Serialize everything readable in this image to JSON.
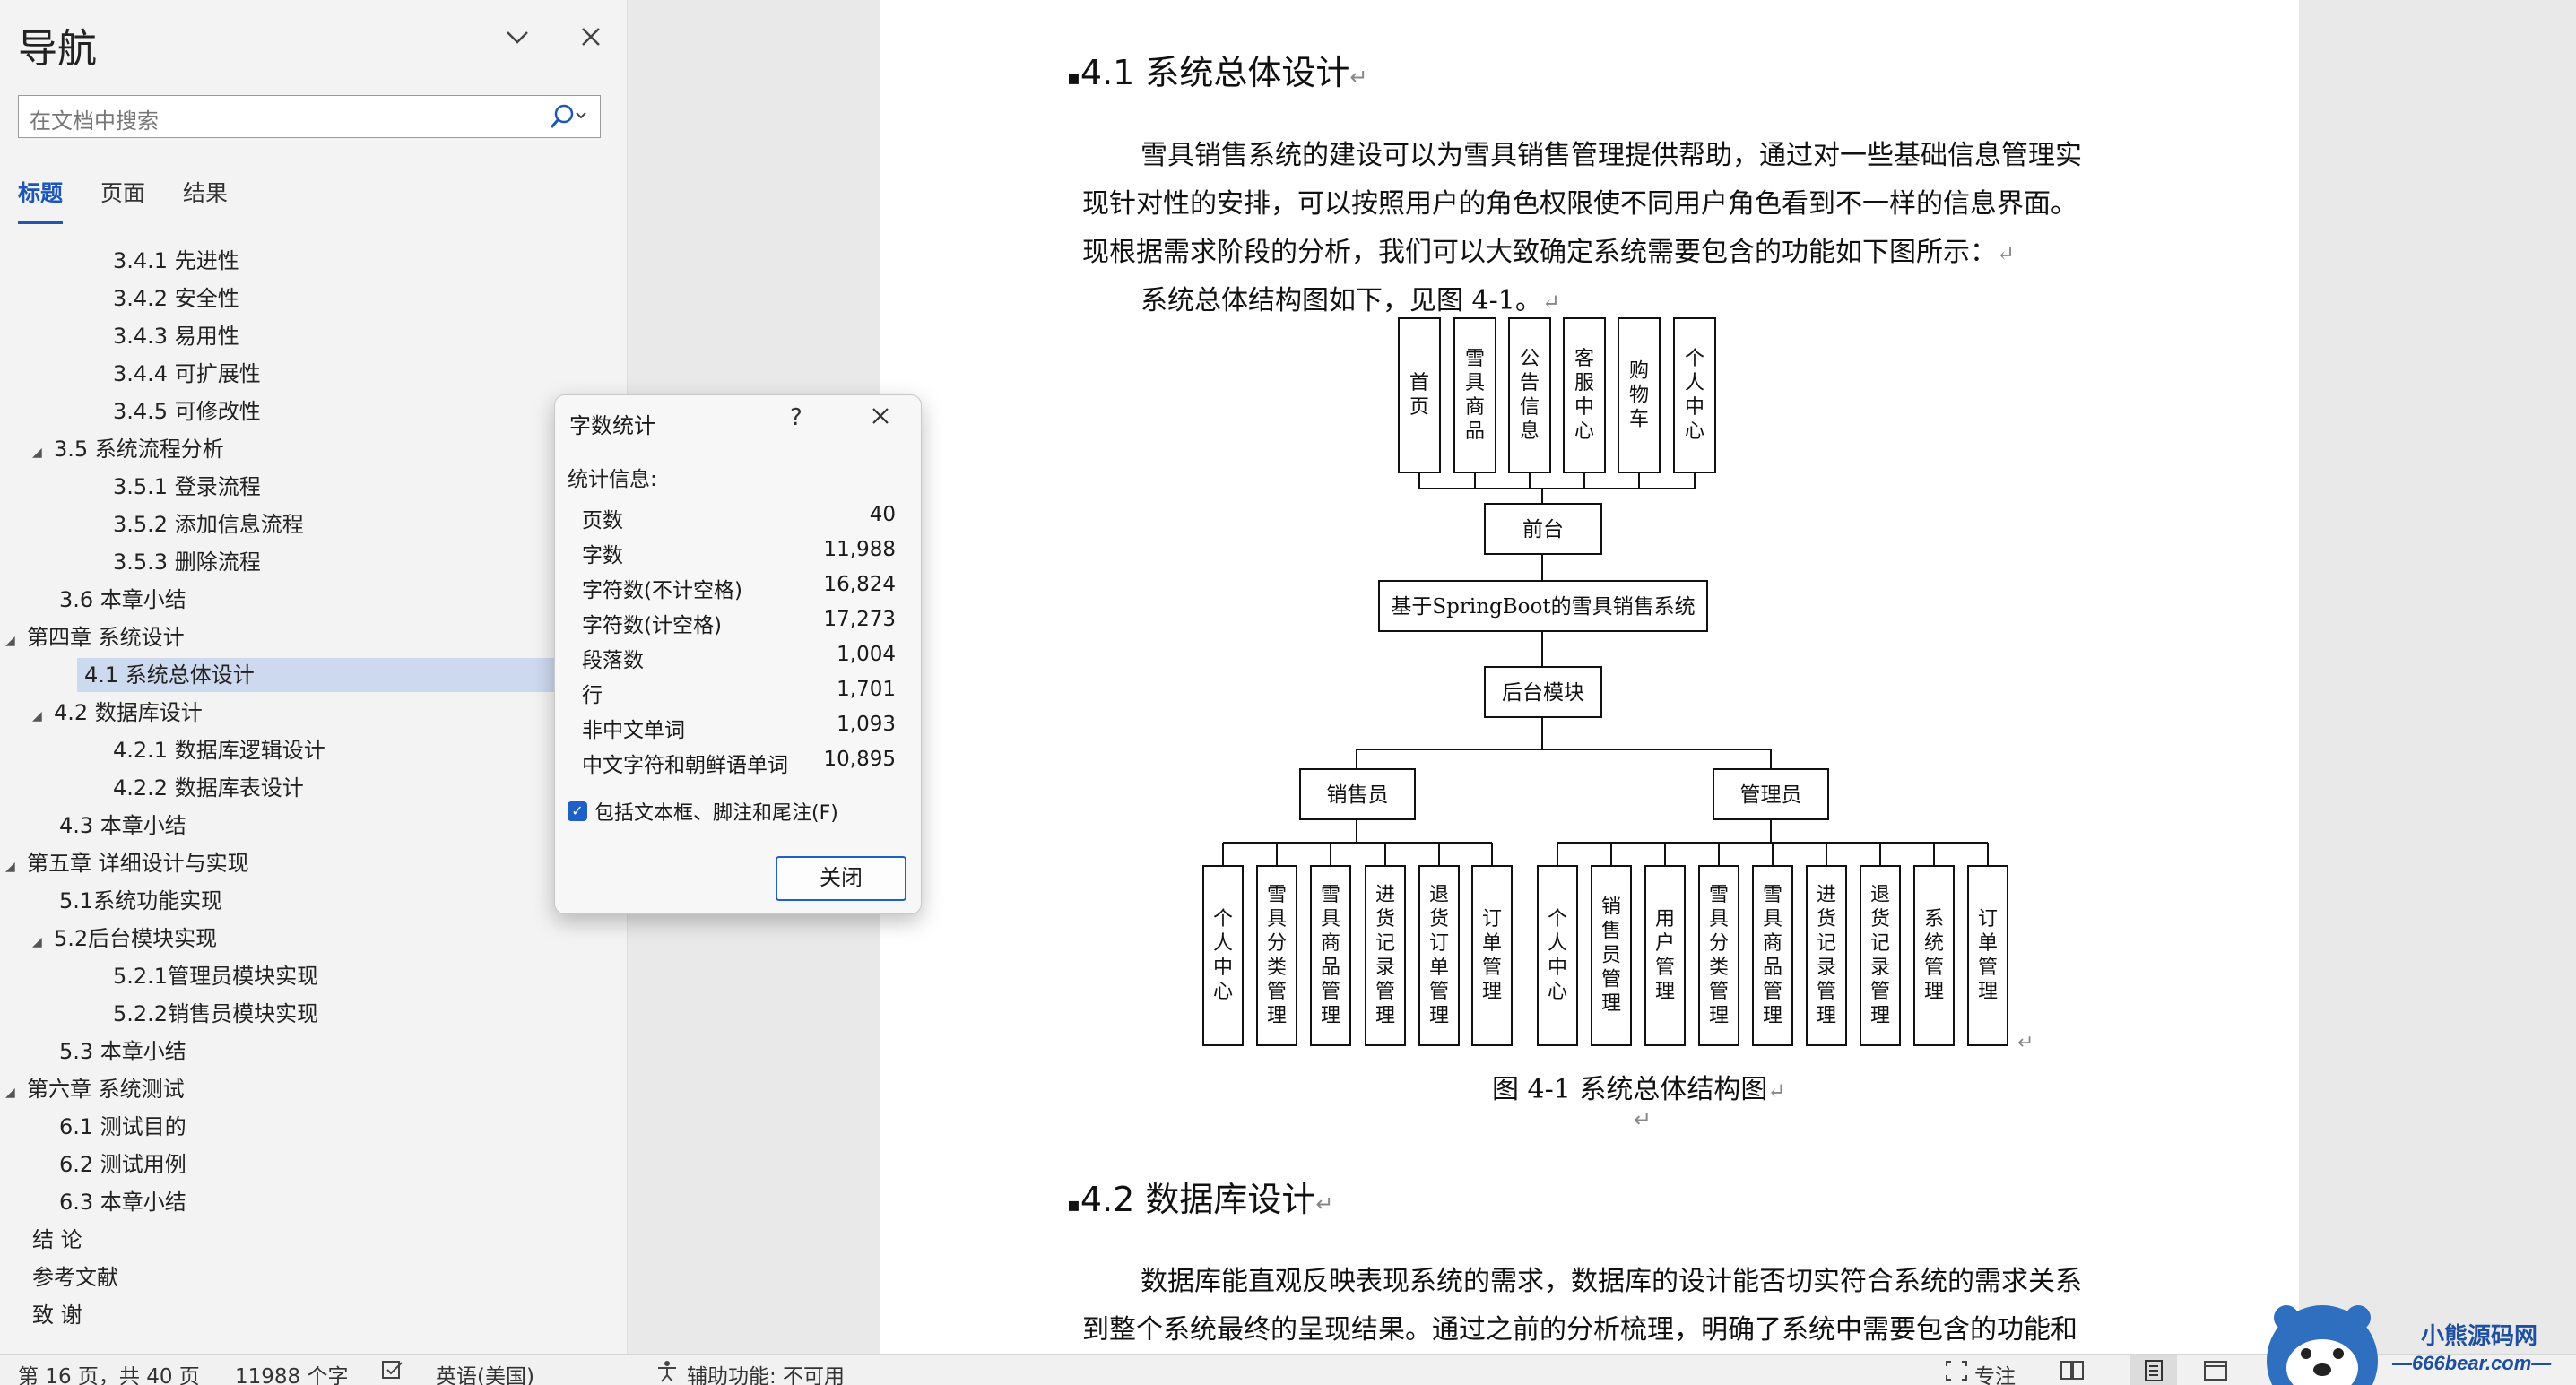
{
  "nav": {
    "title": "导航",
    "search_placeholder": "在文档中搜索",
    "tabs": [
      "标题",
      "页面",
      "结果"
    ],
    "items": [
      {
        "label": "3.4.1 先进性",
        "level": 3,
        "caret": ""
      },
      {
        "label": "3.4.2 安全性",
        "level": 3,
        "caret": ""
      },
      {
        "label": "3.4.3 易用性",
        "level": 3,
        "caret": ""
      },
      {
        "label": "3.4.4 可扩展性",
        "level": 3,
        "caret": ""
      },
      {
        "label": "3.4.5 可修改性",
        "level": 3,
        "caret": ""
      },
      {
        "label": "3.5 系统流程分析",
        "level": 2,
        "caret": "◢"
      },
      {
        "label": "3.5.1 登录流程",
        "level": 3,
        "caret": ""
      },
      {
        "label": "3.5.2 添加信息流程",
        "level": 3,
        "caret": ""
      },
      {
        "label": "3.5.3 删除流程",
        "level": 3,
        "caret": ""
      },
      {
        "label": "3.6 本章小结",
        "level": 2,
        "caret": ""
      },
      {
        "label": "第四章 系统设计",
        "level": 1,
        "caret": "◢"
      },
      {
        "label": "4.1 系统总体设计",
        "level": 2,
        "caret": "",
        "selected": true
      },
      {
        "label": "4.2 数据库设计",
        "level": 2,
        "caret": "◢"
      },
      {
        "label": "4.2.1 数据库逻辑设计",
        "level": 3,
        "caret": ""
      },
      {
        "label": "4.2.2 数据库表设计",
        "level": 3,
        "caret": ""
      },
      {
        "label": "4.3 本章小结",
        "level": 2,
        "caret": ""
      },
      {
        "label": "第五章 详细设计与实现",
        "level": 1,
        "caret": "◢"
      },
      {
        "label": "5.1系统功能实现",
        "level": 2,
        "caret": ""
      },
      {
        "label": "5.2后台模块实现",
        "level": 2,
        "caret": "◢"
      },
      {
        "label": "5.2.1管理员模块实现",
        "level": 3,
        "caret": ""
      },
      {
        "label": "5.2.2销售员模块实现",
        "level": 3,
        "caret": ""
      },
      {
        "label": "5.3 本章小结",
        "level": 2,
        "caret": ""
      },
      {
        "label": "第六章 系统测试",
        "level": 1,
        "caret": "◢"
      },
      {
        "label": "6.1 测试目的",
        "level": 2,
        "caret": ""
      },
      {
        "label": "6.2 测试用例",
        "level": 2,
        "caret": ""
      },
      {
        "label": "6.3 本章小结",
        "level": 2,
        "caret": ""
      },
      {
        "label": "结  论",
        "level": 1,
        "caret": ""
      },
      {
        "label": "参考文献",
        "level": 1,
        "caret": ""
      },
      {
        "label": "致  谢",
        "level": 1,
        "caret": ""
      }
    ]
  },
  "doc": {
    "h41": "4.1  系统总体设计",
    "p1": "雪具销售系统的建设可以为雪具销售管理提供帮助，通过对一些基础信息管理实",
    "p2": "现针对性的安排，可以按照用户的角色权限使不同用户角色看到不一样的信息界面。",
    "p3": "现根据需求阶段的分析，我们可以大致确定系统需要包含的功能如下图所示：",
    "p4": "系统总体结构图如下，见图 4-1。",
    "fig_caption": "图 4-1  系统总体结构图",
    "h42": "4.2  数据库设计",
    "p5": "数据库能直观反映表现系统的需求，数据库的设计能否切实符合系统的需求关系",
    "p6": "到整个系统最终的呈现结果。通过之前的分析梳理，明确了系统中需要包含的功能和",
    "return_mark": "↵"
  },
  "diagram": {
    "front_items": [
      "首页",
      "雪具商品",
      "公告信息",
      "客服中心",
      "购物车",
      "个人中心"
    ],
    "front": "前台",
    "system": "基于SpringBoot的雪具销售系统",
    "backend": "后台模块",
    "seller": "销售员",
    "admin": "管理员",
    "seller_items": [
      "个人中心",
      "雪具分类管理",
      "雪具商品管理",
      "进货记录管理",
      "退货订单管理",
      "订单管理"
    ],
    "admin_items": [
      "个人中心",
      "销售员管理",
      "用户管理",
      "雪具分类管理",
      "雪具商品管理",
      "进货记录管理",
      "退货记录管理",
      "系统管理",
      "订单管理"
    ]
  },
  "dialog": {
    "title": "字数统计",
    "help": "?",
    "section": "统计信息:",
    "stats": [
      {
        "label": "页数",
        "value": "40"
      },
      {
        "label": "字数",
        "value": "11,988"
      },
      {
        "label": "字符数(不计空格)",
        "value": "16,824"
      },
      {
        "label": "字符数(计空格)",
        "value": "17,273"
      },
      {
        "label": "段落数",
        "value": "1,004"
      },
      {
        "label": "行",
        "value": "1,701"
      },
      {
        "label": "非中文单词",
        "value": "1,093"
      },
      {
        "label": "中文字符和朝鲜语单词",
        "value": "10,895"
      }
    ],
    "checkbox_label": "包括文本框、脚注和尾注(F)",
    "checkbox_checked": true,
    "close_label": "关闭"
  },
  "status": {
    "page": "第 16 页，共 40 页",
    "words": "11988 个字",
    "language": "英语(美国)",
    "accessibility": "辅助功能: 不可用",
    "focus": "专注"
  },
  "watermark": {
    "title": "小熊源码网",
    "url": "—666bear.com—"
  },
  "colors": {
    "accent": "#1e56b8",
    "selection": "#cdd9ee"
  }
}
